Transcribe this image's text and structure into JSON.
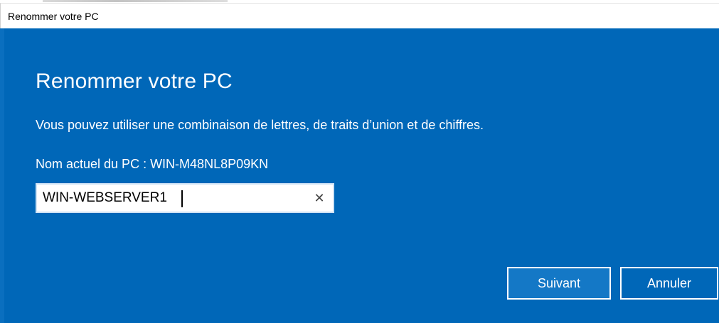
{
  "window": {
    "title": "Renommer votre PC"
  },
  "dialog": {
    "heading": "Renommer votre PC",
    "description": "Vous pouvez utiliser une combinaison de lettres, de traits d’union et de chiffres.",
    "current_name_label": "Nom actuel du PC : WIN-M48NL8P09KN",
    "name_input": {
      "value": "WIN-WEBSERVER1",
      "clear_icon": "close-icon"
    },
    "buttons": {
      "next_label": "Suivant",
      "cancel_label": "Annuler"
    }
  },
  "colors": {
    "dialog_background": "#0067b8",
    "button_border": "#ffffff",
    "text": "#ffffff"
  }
}
